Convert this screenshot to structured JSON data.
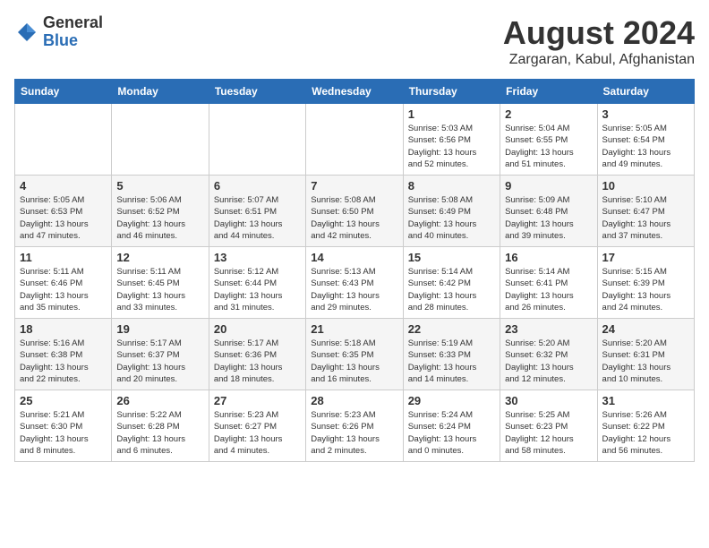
{
  "logo": {
    "general": "General",
    "blue": "Blue"
  },
  "title": "August 2024",
  "location": "Zargaran, Kabul, Afghanistan",
  "days_of_week": [
    "Sunday",
    "Monday",
    "Tuesday",
    "Wednesday",
    "Thursday",
    "Friday",
    "Saturday"
  ],
  "weeks": [
    [
      {
        "day": "",
        "info": ""
      },
      {
        "day": "",
        "info": ""
      },
      {
        "day": "",
        "info": ""
      },
      {
        "day": "",
        "info": ""
      },
      {
        "day": "1",
        "info": "Sunrise: 5:03 AM\nSunset: 6:56 PM\nDaylight: 13 hours\nand 52 minutes."
      },
      {
        "day": "2",
        "info": "Sunrise: 5:04 AM\nSunset: 6:55 PM\nDaylight: 13 hours\nand 51 minutes."
      },
      {
        "day": "3",
        "info": "Sunrise: 5:05 AM\nSunset: 6:54 PM\nDaylight: 13 hours\nand 49 minutes."
      }
    ],
    [
      {
        "day": "4",
        "info": "Sunrise: 5:05 AM\nSunset: 6:53 PM\nDaylight: 13 hours\nand 47 minutes."
      },
      {
        "day": "5",
        "info": "Sunrise: 5:06 AM\nSunset: 6:52 PM\nDaylight: 13 hours\nand 46 minutes."
      },
      {
        "day": "6",
        "info": "Sunrise: 5:07 AM\nSunset: 6:51 PM\nDaylight: 13 hours\nand 44 minutes."
      },
      {
        "day": "7",
        "info": "Sunrise: 5:08 AM\nSunset: 6:50 PM\nDaylight: 13 hours\nand 42 minutes."
      },
      {
        "day": "8",
        "info": "Sunrise: 5:08 AM\nSunset: 6:49 PM\nDaylight: 13 hours\nand 40 minutes."
      },
      {
        "day": "9",
        "info": "Sunrise: 5:09 AM\nSunset: 6:48 PM\nDaylight: 13 hours\nand 39 minutes."
      },
      {
        "day": "10",
        "info": "Sunrise: 5:10 AM\nSunset: 6:47 PM\nDaylight: 13 hours\nand 37 minutes."
      }
    ],
    [
      {
        "day": "11",
        "info": "Sunrise: 5:11 AM\nSunset: 6:46 PM\nDaylight: 13 hours\nand 35 minutes."
      },
      {
        "day": "12",
        "info": "Sunrise: 5:11 AM\nSunset: 6:45 PM\nDaylight: 13 hours\nand 33 minutes."
      },
      {
        "day": "13",
        "info": "Sunrise: 5:12 AM\nSunset: 6:44 PM\nDaylight: 13 hours\nand 31 minutes."
      },
      {
        "day": "14",
        "info": "Sunrise: 5:13 AM\nSunset: 6:43 PM\nDaylight: 13 hours\nand 29 minutes."
      },
      {
        "day": "15",
        "info": "Sunrise: 5:14 AM\nSunset: 6:42 PM\nDaylight: 13 hours\nand 28 minutes."
      },
      {
        "day": "16",
        "info": "Sunrise: 5:14 AM\nSunset: 6:41 PM\nDaylight: 13 hours\nand 26 minutes."
      },
      {
        "day": "17",
        "info": "Sunrise: 5:15 AM\nSunset: 6:39 PM\nDaylight: 13 hours\nand 24 minutes."
      }
    ],
    [
      {
        "day": "18",
        "info": "Sunrise: 5:16 AM\nSunset: 6:38 PM\nDaylight: 13 hours\nand 22 minutes."
      },
      {
        "day": "19",
        "info": "Sunrise: 5:17 AM\nSunset: 6:37 PM\nDaylight: 13 hours\nand 20 minutes."
      },
      {
        "day": "20",
        "info": "Sunrise: 5:17 AM\nSunset: 6:36 PM\nDaylight: 13 hours\nand 18 minutes."
      },
      {
        "day": "21",
        "info": "Sunrise: 5:18 AM\nSunset: 6:35 PM\nDaylight: 13 hours\nand 16 minutes."
      },
      {
        "day": "22",
        "info": "Sunrise: 5:19 AM\nSunset: 6:33 PM\nDaylight: 13 hours\nand 14 minutes."
      },
      {
        "day": "23",
        "info": "Sunrise: 5:20 AM\nSunset: 6:32 PM\nDaylight: 13 hours\nand 12 minutes."
      },
      {
        "day": "24",
        "info": "Sunrise: 5:20 AM\nSunset: 6:31 PM\nDaylight: 13 hours\nand 10 minutes."
      }
    ],
    [
      {
        "day": "25",
        "info": "Sunrise: 5:21 AM\nSunset: 6:30 PM\nDaylight: 13 hours\nand 8 minutes."
      },
      {
        "day": "26",
        "info": "Sunrise: 5:22 AM\nSunset: 6:28 PM\nDaylight: 13 hours\nand 6 minutes."
      },
      {
        "day": "27",
        "info": "Sunrise: 5:23 AM\nSunset: 6:27 PM\nDaylight: 13 hours\nand 4 minutes."
      },
      {
        "day": "28",
        "info": "Sunrise: 5:23 AM\nSunset: 6:26 PM\nDaylight: 13 hours\nand 2 minutes."
      },
      {
        "day": "29",
        "info": "Sunrise: 5:24 AM\nSunset: 6:24 PM\nDaylight: 13 hours\nand 0 minutes."
      },
      {
        "day": "30",
        "info": "Sunrise: 5:25 AM\nSunset: 6:23 PM\nDaylight: 12 hours\nand 58 minutes."
      },
      {
        "day": "31",
        "info": "Sunrise: 5:26 AM\nSunset: 6:22 PM\nDaylight: 12 hours\nand 56 minutes."
      }
    ]
  ]
}
